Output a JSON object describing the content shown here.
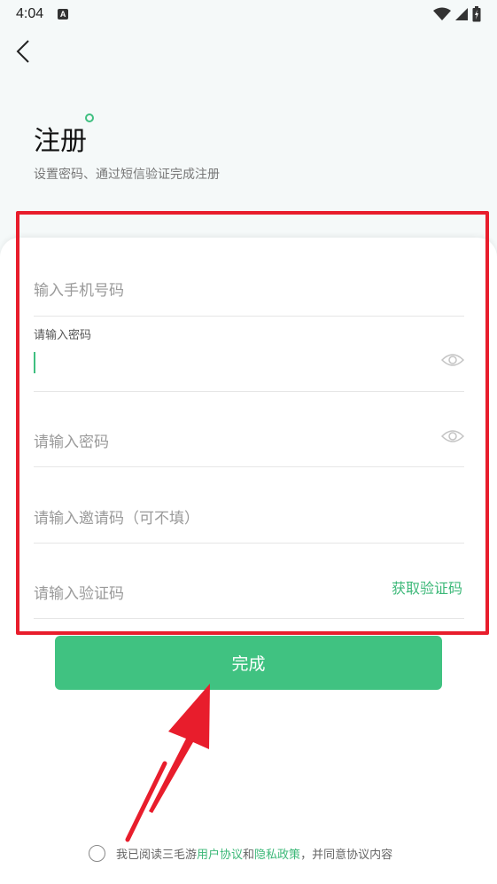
{
  "status_bar": {
    "time": "4:04",
    "notification_icon": "a-icon"
  },
  "header": {
    "back_icon": "chevron-left-icon",
    "title": "注册",
    "subtitle": "设置密码、通过短信验证完成注册"
  },
  "form": {
    "phone_placeholder": "输入手机号码",
    "password_label": "请输入密码",
    "password_value": "",
    "confirm_password_placeholder": "请输入密码",
    "invite_code_placeholder": "请输入邀请码（可不填）",
    "verify_code_placeholder": "请输入验证码",
    "get_code_label": "获取验证码"
  },
  "actions": {
    "done_label": "完成"
  },
  "agreement": {
    "prefix": "我已阅读三毛游",
    "user_agreement": "用户协议",
    "and": "和",
    "privacy_policy": "隐私政策",
    "suffix": "，并同意协议内容",
    "checked": false
  },
  "colors": {
    "accent": "#40c281",
    "highlight": "#e81d2c"
  }
}
